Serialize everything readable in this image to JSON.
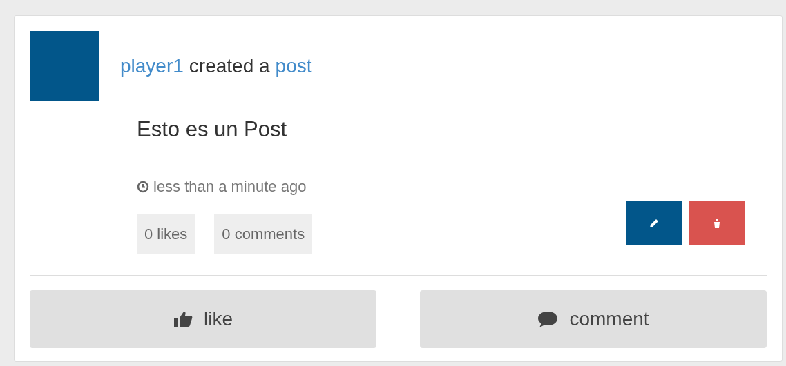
{
  "author": {
    "name": "player1",
    "action": "created a",
    "object": "post"
  },
  "post": {
    "text": "Esto es un Post",
    "time": "less than a minute ago"
  },
  "stats": [
    "0 likes",
    "0 comments"
  ],
  "actions": [
    {
      "kind": "edit"
    },
    {
      "kind": "delete"
    }
  ],
  "buttons": [
    {
      "kind": "like",
      "label": "like"
    },
    {
      "kind": "comment",
      "label": "comment"
    }
  ]
}
